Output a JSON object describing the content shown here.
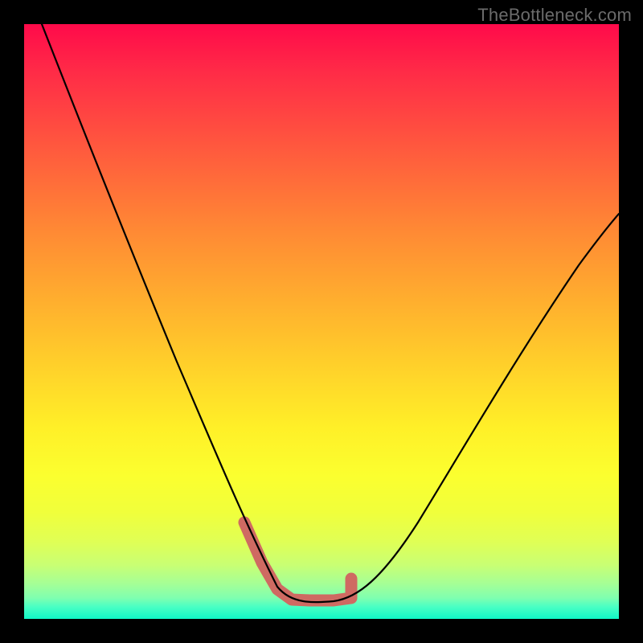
{
  "watermark": {
    "text": "TheBottleneck.com"
  },
  "chart_data": {
    "type": "line",
    "title": "",
    "xlabel": "",
    "ylabel": "",
    "xlim": [
      0,
      100
    ],
    "ylim": [
      0,
      100
    ],
    "grid": false,
    "legend": null,
    "background_gradient_stops": [
      {
        "pos": 0,
        "color": "#ff0a4a"
      },
      {
        "pos": 22,
        "color": "#ff5d3d"
      },
      {
        "pos": 47,
        "color": "#ffb02e"
      },
      {
        "pos": 68,
        "color": "#fff028"
      },
      {
        "pos": 87,
        "color": "#e0ff55"
      },
      {
        "pos": 100,
        "color": "#10f7c6"
      }
    ],
    "series": [
      {
        "name": "bottleneck-curve",
        "x": [
          3,
          8,
          14,
          20,
          26,
          30,
          34,
          37,
          40,
          42.5,
          45,
          48,
          52,
          55,
          60,
          66,
          74,
          82,
          90,
          100
        ],
        "y": [
          100,
          86,
          72,
          58,
          44,
          34,
          24,
          16,
          9,
          5,
          3.2,
          3.0,
          3.0,
          3.4,
          6,
          12,
          24,
          38,
          52,
          68
        ],
        "color": "#000000"
      }
    ],
    "highlight_segment": {
      "description": "thick salmon segment marking the curve minimum",
      "approx_x_range": [
        37,
        55
      ],
      "approx_y_range": [
        3,
        16
      ],
      "color": "#cf6a62"
    }
  }
}
